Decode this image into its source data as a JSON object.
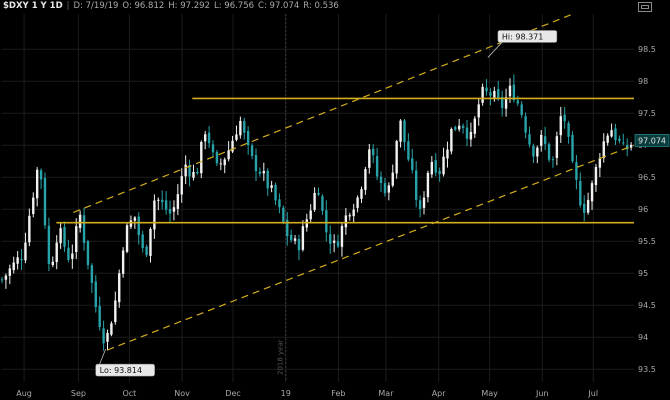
{
  "header": {
    "symbol": "$DXY",
    "timeframe": "1 Y 1D",
    "date": "D: 7/19/19",
    "open": "O: 96.812",
    "high": "H: 97.292",
    "low": "L: 96.756",
    "close": "C: 97.074",
    "range": "R: 0.536"
  },
  "chart_data": {
    "type": "candlestick",
    "ylim": [
      93.3,
      99.05
    ],
    "y_ticks": [
      {
        "label": "98.5",
        "value": 98.5
      },
      {
        "label": "98",
        "value": 98.0
      },
      {
        "label": "97.5",
        "value": 97.5
      },
      {
        "label": "97",
        "value": 97.0
      },
      {
        "label": "96.5",
        "value": 96.5
      },
      {
        "label": "96",
        "value": 96.0
      },
      {
        "label": "95.5",
        "value": 95.5
      },
      {
        "label": "95",
        "value": 95.0
      },
      {
        "label": "94.5",
        "value": 94.5
      },
      {
        "label": "94",
        "value": 94.0
      },
      {
        "label": "93.5",
        "value": 93.5
      }
    ],
    "x_ticks": [
      {
        "label": "Aug",
        "day": 13
      },
      {
        "label": "Sep",
        "day": 45
      },
      {
        "label": "Oct",
        "day": 75
      },
      {
        "label": "Nov",
        "day": 106
      },
      {
        "label": "Dec",
        "day": 136
      },
      {
        "label": "19",
        "day": 167
      },
      {
        "label": "Feb",
        "day": 198
      },
      {
        "label": "Mar",
        "day": 226
      },
      {
        "label": "Apr",
        "day": 257
      },
      {
        "label": "May",
        "day": 287
      },
      {
        "label": "Jun",
        "day": 318
      },
      {
        "label": "Jul",
        "day": 348
      }
    ],
    "year_marker": {
      "label": "2018 year",
      "day": 167
    },
    "x_domain": [
      0,
      372
    ],
    "path_keypoints": [
      [
        0,
        94.9
      ],
      [
        12,
        95.3
      ],
      [
        22,
        96.8
      ],
      [
        28,
        95.0
      ],
      [
        33,
        95.7
      ],
      [
        40,
        95.2
      ],
      [
        46,
        95.9
      ],
      [
        55,
        94.5
      ],
      [
        61,
        93.9
      ],
      [
        67,
        94.6
      ],
      [
        72,
        95.6
      ],
      [
        78,
        95.9
      ],
      [
        84,
        95.2
      ],
      [
        90,
        96.2
      ],
      [
        100,
        95.9
      ],
      [
        108,
        96.7
      ],
      [
        114,
        96.5
      ],
      [
        120,
        97.3
      ],
      [
        126,
        96.6
      ],
      [
        133,
        96.9
      ],
      [
        140,
        97.4
      ],
      [
        146,
        96.8
      ],
      [
        152,
        96.6
      ],
      [
        160,
        96.2
      ],
      [
        168,
        95.6
      ],
      [
        174,
        95.4
      ],
      [
        180,
        95.9
      ],
      [
        186,
        96.4
      ],
      [
        190,
        95.7
      ],
      [
        196,
        95.4
      ],
      [
        204,
        96.0
      ],
      [
        210,
        96.2
      ],
      [
        216,
        97.0
      ],
      [
        222,
        96.4
      ],
      [
        228,
        96.3
      ],
      [
        234,
        97.4
      ],
      [
        240,
        96.7
      ],
      [
        246,
        95.9
      ],
      [
        252,
        96.8
      ],
      [
        258,
        96.6
      ],
      [
        264,
        97.2
      ],
      [
        270,
        97.4
      ],
      [
        276,
        97.1
      ],
      [
        282,
        97.8
      ],
      [
        288,
        97.8
      ],
      [
        294,
        97.6
      ],
      [
        300,
        97.9
      ],
      [
        306,
        97.5
      ],
      [
        312,
        96.9
      ],
      [
        318,
        97.1
      ],
      [
        324,
        96.7
      ],
      [
        330,
        97.6
      ],
      [
        336,
        96.6
      ],
      [
        342,
        96.0
      ],
      [
        346,
        96.2
      ],
      [
        352,
        96.9
      ],
      [
        358,
        97.3
      ],
      [
        366,
        96.9
      ],
      [
        372,
        97.07
      ]
    ],
    "candle_spacing_days": 2.3,
    "colors": {
      "up": "#f2f2f2",
      "down": "#28a3a9",
      "trendline": "#d4ad1c",
      "grid": "#1c1c1c",
      "axis_text": "#a8a8a8"
    },
    "horizontal_lines": [
      {
        "value": 97.73,
        "x_start_day": 112,
        "x_end_day": 372
      },
      {
        "value": 95.79,
        "x_start_day": 32,
        "x_end_day": 372
      }
    ],
    "channel_lines": [
      {
        "style": "dashed",
        "from": [
          42,
          95.95
        ],
        "to": [
          336,
          99.05
        ]
      },
      {
        "style": "dashed",
        "from": [
          62,
          93.8
        ],
        "to": [
          372,
          97.0
        ]
      }
    ],
    "annotations": [
      {
        "label": "Hi: 98.371",
        "day": 286,
        "value": 98.371,
        "type": "high"
      },
      {
        "label": "Lo: 93.814",
        "day": 61,
        "value": 93.814,
        "type": "low"
      }
    ],
    "last_price": {
      "label": "97.074",
      "value": 97.074
    }
  }
}
